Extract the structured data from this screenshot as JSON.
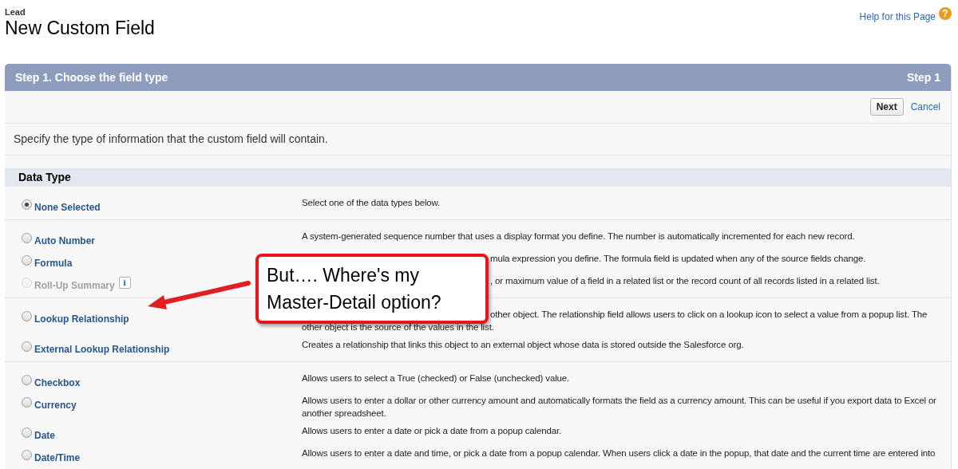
{
  "page": {
    "object": "Lead",
    "title": "New Custom Field",
    "help_link": "Help for this Page",
    "help_icon": "?"
  },
  "step": {
    "title": "Step 1. Choose the field type",
    "counter": "Step 1"
  },
  "buttons": {
    "next": "Next",
    "cancel": "Cancel"
  },
  "intro": "Specify the type of information that the custom field will contain.",
  "section": "Data Type",
  "groups": [
    {
      "items": [
        {
          "label": "None Selected",
          "selected": true,
          "disabled": false,
          "lines": [
            {
              "text": "Select one of the data types below."
            }
          ]
        }
      ]
    },
    {
      "items": [
        {
          "label": "Auto Number",
          "selected": false,
          "disabled": false,
          "lines": [
            {
              "text": "A system-generated sequence number that uses a display format you define. The number is automatically incremented for each new record."
            }
          ]
        },
        {
          "label": "Formula",
          "selected": false,
          "disabled": false,
          "lines": [
            {
              "after_callout": "mula expression you define. The formula field is updated when any of the source fields change."
            }
          ]
        },
        {
          "label": "Roll-Up Summary",
          "selected": false,
          "disabled": true,
          "info": "i",
          "lines": [
            {
              "after_callout": ", or maximum value of a field in a related list or the record count of all records listed in a related list."
            }
          ]
        }
      ]
    },
    {
      "items": [
        {
          "label": "Lookup Relationship",
          "selected": false,
          "disabled": false,
          "lines": [
            {
              "after_callout": "other object. The relationship field allows users to click on a lookup icon to select a value from a popup list. The"
            },
            {
              "text": "other object is the source of the values in the list."
            }
          ]
        },
        {
          "label": "External Lookup Relationship",
          "selected": false,
          "disabled": false,
          "lines": [
            {
              "text": "Creates a relationship that links this object to an external object whose data is stored outside the Salesforce org."
            }
          ]
        }
      ]
    },
    {
      "items": [
        {
          "label": "Checkbox",
          "selected": false,
          "disabled": false,
          "lines": [
            {
              "text": "Allows users to select a True (checked) or False (unchecked) value."
            }
          ]
        },
        {
          "label": "Currency",
          "selected": false,
          "disabled": false,
          "lines": [
            {
              "text": "Allows users to enter a dollar or other currency amount and automatically formats the field as a currency amount. This can be useful if you export data to Excel or another spreadsheet."
            }
          ]
        },
        {
          "label": "Date",
          "selected": false,
          "disabled": false,
          "lines": [
            {
              "text": "Allows users to enter a date or pick a date from a popup calendar."
            }
          ]
        },
        {
          "label": "Date/Time",
          "selected": false,
          "disabled": false,
          "lines": [
            {
              "text": "Allows users to enter a date and time, or pick a date from a popup calendar. When users click a date in the popup, that date and the current time are entered into"
            }
          ]
        }
      ]
    }
  ],
  "callout": {
    "text": "But…. Where's my Master-Detail option?"
  }
}
